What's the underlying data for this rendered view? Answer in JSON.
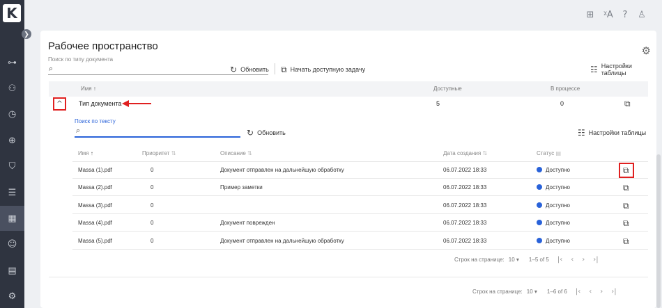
{
  "app": {
    "logo_letter": "K"
  },
  "sidebar": {
    "expand_icon": "chevron-right-icon",
    "items": [
      {
        "name": "workflow-icon",
        "glyph": "⊶"
      },
      {
        "name": "hierarchy-icon",
        "glyph": "⚇"
      },
      {
        "name": "clock-icon",
        "glyph": "◷"
      },
      {
        "name": "network-icon",
        "glyph": "⊕"
      },
      {
        "name": "shield-check-icon",
        "glyph": "⛉"
      },
      {
        "name": "checklist-icon",
        "glyph": "☰"
      },
      {
        "name": "workspace-icon",
        "glyph": "▦"
      },
      {
        "name": "robot-icon",
        "glyph": "☺"
      },
      {
        "name": "calendar-icon",
        "glyph": "▤"
      },
      {
        "name": "settings-icon",
        "glyph": "⚙"
      }
    ],
    "active_index": 6
  },
  "topbar": {
    "icons": [
      "grid-icon",
      "translate-icon",
      "help-icon",
      "user-icon"
    ]
  },
  "page": {
    "title": "Рабочее пространство",
    "search_label": "Поиск по типу документа",
    "refresh_label": "Обновить",
    "start_task_label": "Начать доступную задачу",
    "table_settings_label": "Настройки таблицы"
  },
  "outer_table": {
    "headers": {
      "name": "Имя",
      "available": "Доступные",
      "in_progress": "В процессе"
    },
    "row": {
      "name": "Тип документа",
      "available": "5",
      "in_progress": "0"
    },
    "pager": {
      "rows_label": "Строк на странице:",
      "rows_value": "10",
      "range": "1–6 of 6"
    }
  },
  "inner": {
    "search_label": "Поиск по тексту",
    "refresh_label": "Обновить",
    "table_settings_label": "Настройки таблицы",
    "headers": {
      "name": "Имя",
      "priority": "Приоритет",
      "description": "Описание",
      "created": "Дата создания",
      "status": "Статус"
    },
    "rows": [
      {
        "name": "Massa (1).pdf",
        "priority": "0",
        "description": "Документ отправлен на дальнейшую обработку",
        "created": "06.07.2022 18:33",
        "status": "Доступно"
      },
      {
        "name": "Massa (2).pdf",
        "priority": "0",
        "description": "Пример заметки",
        "created": "06.07.2022 18:33",
        "status": "Доступно"
      },
      {
        "name": "Massa (3).pdf",
        "priority": "0",
        "description": "",
        "created": "06.07.2022 18:33",
        "status": "Доступно"
      },
      {
        "name": "Massa (4).pdf",
        "priority": "0",
        "description": "Документ поврежден",
        "created": "06.07.2022 18:33",
        "status": "Доступно"
      },
      {
        "name": "Massa (5).pdf",
        "priority": "0",
        "description": "Документ отправлен на дальнейшую обработку",
        "created": "06.07.2022 18:33",
        "status": "Доступно"
      }
    ],
    "pager": {
      "rows_label": "Строк на странице:",
      "rows_value": "10",
      "range": "1–5 of 5"
    }
  },
  "colors": {
    "accent": "#2962d9",
    "highlight": "#e02020",
    "sidebar": "#2f3440"
  }
}
